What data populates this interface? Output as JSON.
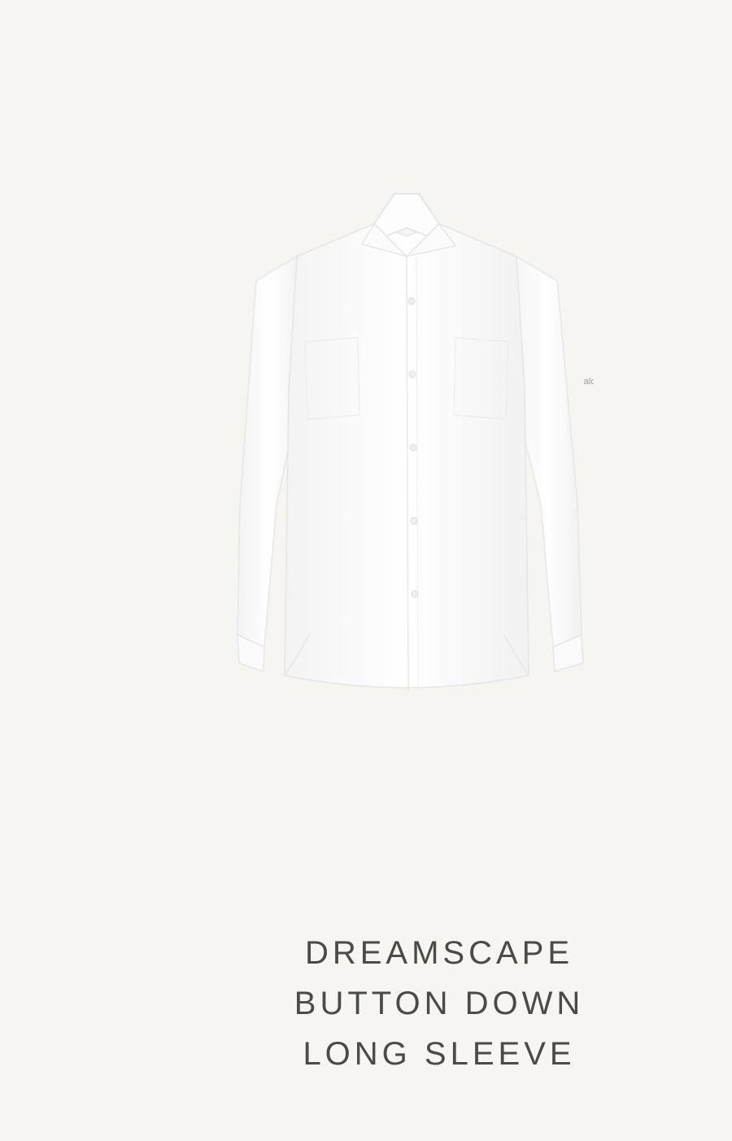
{
  "product": {
    "image_icon": "white-button-down-shirt",
    "sleeve_logo_text": "alo",
    "title_lines": [
      "DREAMSCAPE",
      "BUTTON DOWN",
      "LONG SLEEVE"
    ]
  },
  "colors": {
    "background": "#f6f5f2",
    "shirt": "#ffffff",
    "title": "#4a4a47"
  }
}
